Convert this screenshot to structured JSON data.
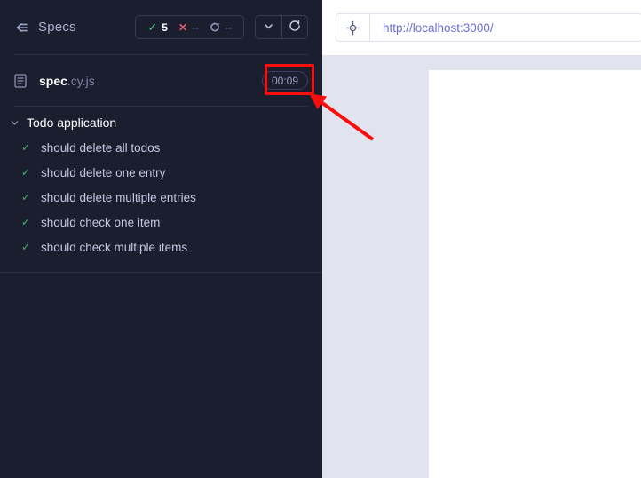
{
  "sidebar": {
    "header": {
      "collapse_icon": "collapse-left-icon",
      "title": "Specs",
      "stats": [
        {
          "name": "passed",
          "icon": "check-icon",
          "glyph": "✓",
          "value": "5",
          "color": "#44d07b"
        },
        {
          "name": "failed",
          "icon": "cross-icon",
          "glyph": "✕",
          "value": "--",
          "color": "#e45b6c"
        },
        {
          "name": "pending",
          "icon": "pending-icon",
          "glyph": "↺",
          "value": "--",
          "color": "#8d93b4"
        }
      ],
      "buttons": [
        {
          "name": "chevron-down-button",
          "icon": "chevron-down-icon"
        },
        {
          "name": "reload-button",
          "icon": "reload-icon"
        }
      ]
    },
    "spec": {
      "icon": "file-document-icon",
      "name_base": "spec",
      "name_ext": ".cy.js",
      "timer": "00:09"
    },
    "suite": {
      "chevron": "chevron-down-icon",
      "label": "Todo application"
    },
    "tests": [
      {
        "status_glyph": "✓",
        "label": "should delete all todos"
      },
      {
        "status_glyph": "✓",
        "label": "should delete one entry"
      },
      {
        "status_glyph": "✓",
        "label": "should delete multiple entries"
      },
      {
        "status_glyph": "✓",
        "label": "should check one item"
      },
      {
        "status_glyph": "✓",
        "label": "should check multiple items"
      }
    ]
  },
  "browser": {
    "selector_icon": "selector-playground-crosshair-icon",
    "url": "http://localhost:3000/"
  },
  "annotations": {
    "highlight_target": "00:09",
    "arrow_color": "#fb0d0d",
    "box_color": "#fb0d0d"
  },
  "colors": {
    "sidebar_bg": "#1b1e2e",
    "divider": "#2a2f45",
    "pass_green": "#3fb96e",
    "url_blue": "#6b6fd6",
    "preview_bg": "#e1e4ee"
  }
}
